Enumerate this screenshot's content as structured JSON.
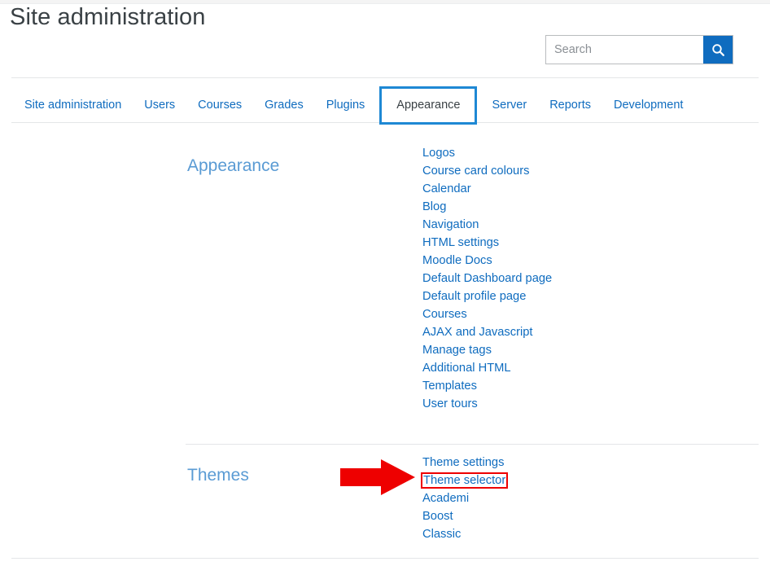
{
  "page": {
    "title": "Site administration"
  },
  "search": {
    "placeholder": "Search",
    "value": "",
    "icon": "search-icon",
    "button_color": "#0f6cbf"
  },
  "tabs": [
    {
      "label": "Site administration",
      "active": false
    },
    {
      "label": "Users",
      "active": false
    },
    {
      "label": "Courses",
      "active": false
    },
    {
      "label": "Grades",
      "active": false
    },
    {
      "label": "Plugins",
      "active": false
    },
    {
      "label": "Appearance",
      "active": true
    },
    {
      "label": "Server",
      "active": false
    },
    {
      "label": "Reports",
      "active": false
    },
    {
      "label": "Development",
      "active": false
    }
  ],
  "sections": [
    {
      "heading": "Appearance",
      "links": [
        "Logos",
        "Course card colours",
        "Calendar",
        "Blog",
        "Navigation",
        "HTML settings",
        "Moodle Docs",
        "Default Dashboard page",
        "Default profile page",
        "Courses",
        "AJAX and Javascript",
        "Manage tags",
        "Additional HTML",
        "Templates",
        "User tours"
      ]
    },
    {
      "heading": "Themes",
      "links": [
        "Theme settings",
        "Theme selector",
        "Academi",
        "Boost",
        "Classic"
      ],
      "highlighted_link": "Theme selector"
    }
  ],
  "annotation": {
    "type": "arrow",
    "color": "#ee0000",
    "points_to": "Theme selector",
    "highlight_box_color": "#ee0000"
  },
  "colors": {
    "link": "#0f6cbf",
    "heading": "#5a9bd4",
    "tab_active_border": "#1e88d4",
    "annotation_red": "#ee0000"
  }
}
